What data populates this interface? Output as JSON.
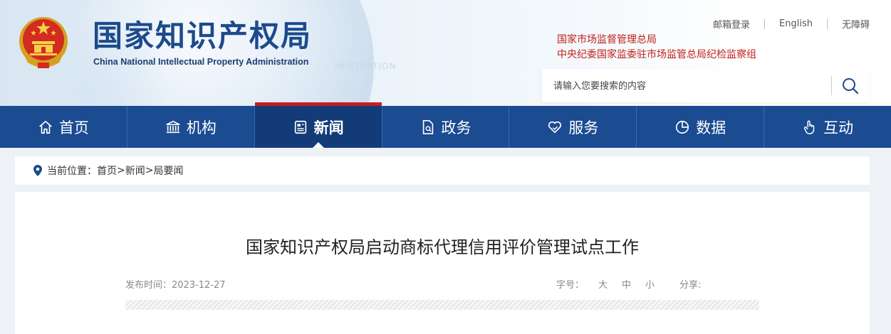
{
  "header": {
    "logo_cn": "国家知识产权局",
    "logo_en": "China National Intellectual Property Administration",
    "watermark": "INISTRATION",
    "top_links": [
      "邮箱登录",
      "English",
      "无障碍"
    ],
    "related_orgs": [
      "国家市场监督管理总局",
      "中央纪委国家监委驻市场监管总局纪检监察组"
    ],
    "search": {
      "placeholder": "请输入您要搜索的内容",
      "icon": "search-icon"
    }
  },
  "nav": {
    "items": [
      {
        "label": "首页",
        "icon": "home-icon"
      },
      {
        "label": "机构",
        "icon": "institution-icon"
      },
      {
        "label": "新闻",
        "icon": "news-icon",
        "active": true
      },
      {
        "label": "政务",
        "icon": "document-icon"
      },
      {
        "label": "服务",
        "icon": "heart-hand-icon"
      },
      {
        "label": "数据",
        "icon": "pie-chart-icon"
      },
      {
        "label": "互动",
        "icon": "hand-pointer-icon"
      }
    ]
  },
  "breadcrumb": {
    "prefix": "当前位置：",
    "items": [
      "首页",
      "新闻",
      "局要闻"
    ],
    "separator": ">"
  },
  "article": {
    "title": "国家知识产权局启动商标代理信用评价管理试点工作",
    "publish_time": "发布时间：2023-12-27",
    "font_size_label": "字号：",
    "font_sizes": [
      "大",
      "中",
      "小"
    ],
    "share_label": "分享:"
  },
  "colors": {
    "nav_bg": "#1b4b91",
    "nav_active": "#123b78",
    "accent_red": "#c41e24",
    "logo_blue": "#1c4a8c"
  }
}
